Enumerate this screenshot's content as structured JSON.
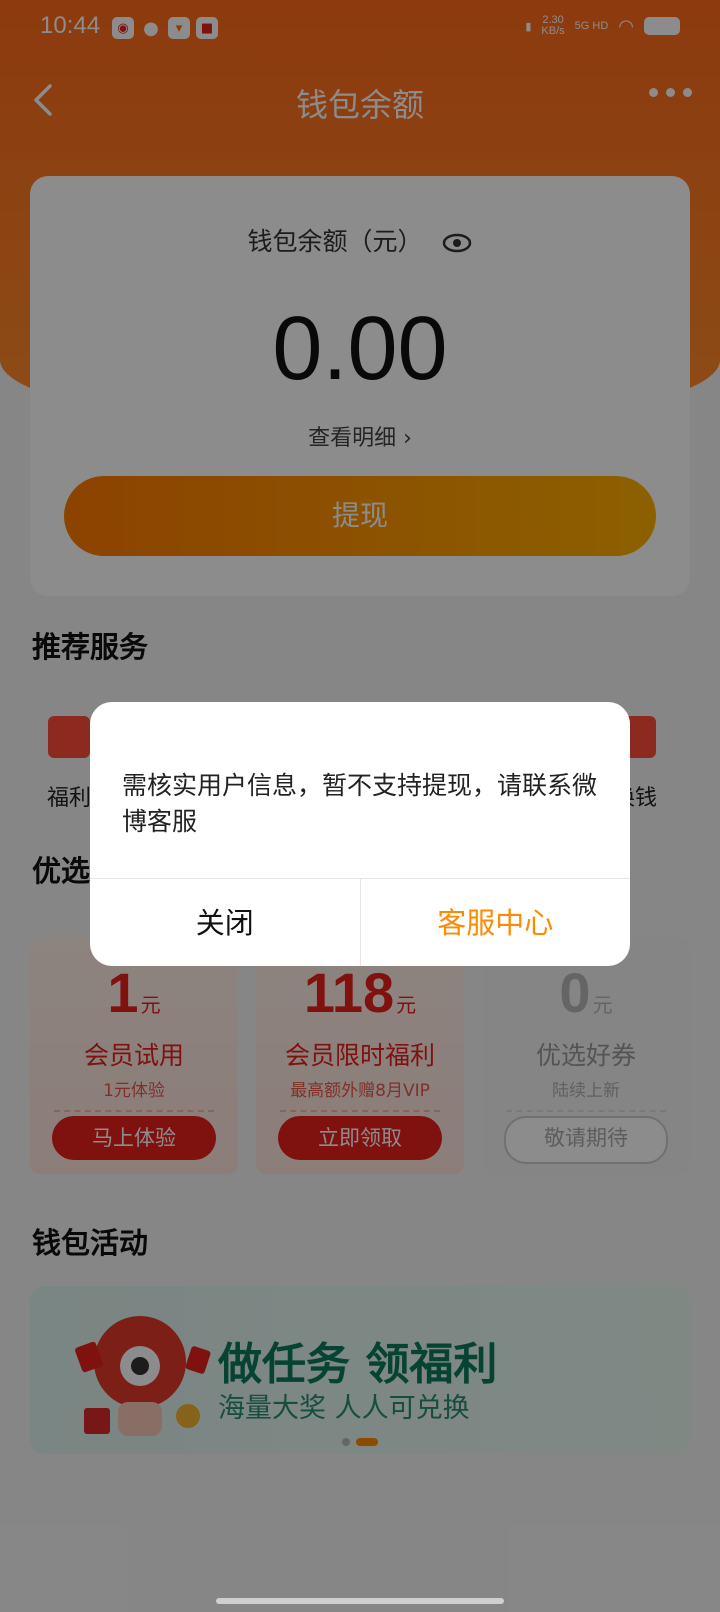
{
  "status_bar": {
    "time": "10:44",
    "net_speed": "2.30",
    "net_unit": "KB/s",
    "net_type": "5G HD"
  },
  "header": {
    "title": "钱包余额"
  },
  "balance": {
    "label": "钱包余额（元）",
    "value": "0.00",
    "detail_link": "查看明细",
    "withdraw_button": "提现"
  },
  "services": {
    "title": "推荐服务",
    "items": [
      {
        "label": "福利"
      },
      {
        "label": "换钱"
      }
    ]
  },
  "coupons": {
    "title": "优选",
    "items": [
      {
        "amount": "1",
        "unit": "元",
        "title": "会员试用",
        "subtitle": "1元体验",
        "button": "马上体验"
      },
      {
        "amount": "118",
        "unit": "元",
        "title": "会员限时福利",
        "subtitle": "最高额外赠8月VIP",
        "button": "立即领取"
      },
      {
        "amount": "0",
        "unit": "元",
        "title": "优选好券",
        "subtitle": "陆续上新",
        "button": "敬请期待"
      }
    ]
  },
  "activity": {
    "title": "钱包活动",
    "banner_title": "做任务 领福利",
    "banner_subtitle": "海量大奖 人人可兑换"
  },
  "dialog": {
    "message": "需核实用户信息，暂不支持提现，请联系微博客服",
    "close_button": "关闭",
    "service_button": "客服中心"
  },
  "colors": {
    "primary": "#ff7a1a",
    "dialog_action": "#ff8a00",
    "coupon_red": "#e8201c"
  }
}
